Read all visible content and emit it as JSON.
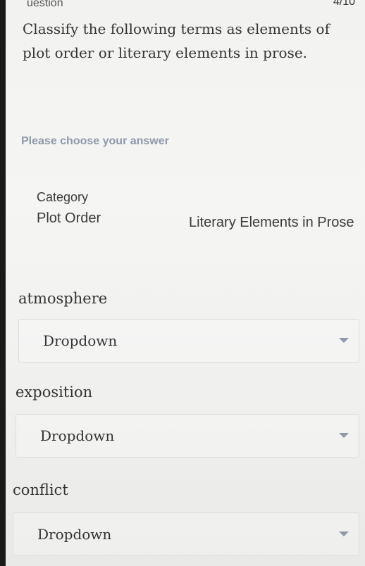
{
  "header": {
    "label": "uestion",
    "progress": "4/10"
  },
  "question": {
    "text": "Classify the following terms as elements of plot order or literary elements in prose."
  },
  "prompt": "Please choose your answer",
  "categories": {
    "label": "Category",
    "items": [
      "Plot Order",
      "Literary Elements in Prose"
    ]
  },
  "terms": [
    {
      "term": "atmosphere",
      "dropdown": "Dropdown"
    },
    {
      "term": "exposition",
      "dropdown": "Dropdown"
    },
    {
      "term": "conflict",
      "dropdown": "Dropdown"
    }
  ],
  "colors": {
    "prompt_text": "#8f98aa",
    "caret": "#8f98aa",
    "body_text": "#333333"
  },
  "icons": {
    "dropdown_caret": "caret-down-icon"
  }
}
